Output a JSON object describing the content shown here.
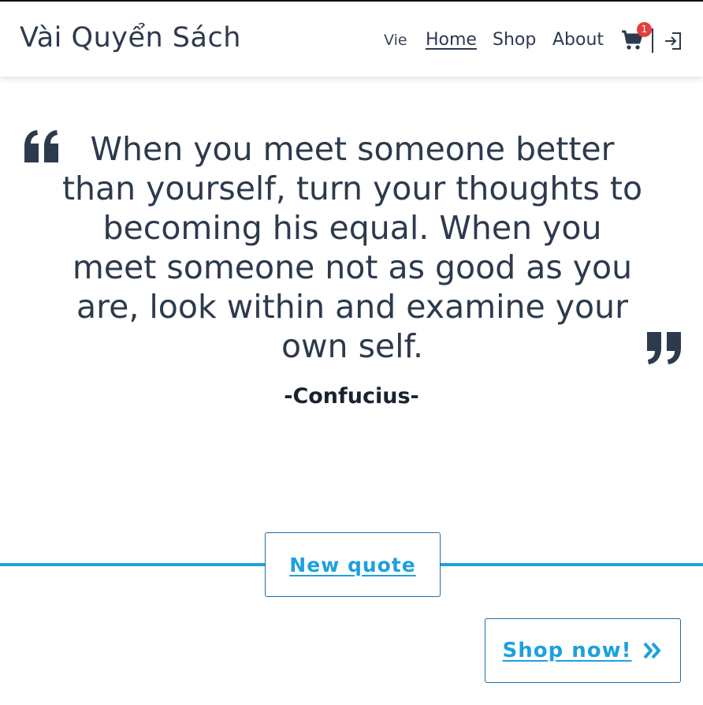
{
  "header": {
    "brand": "Vài Quyển Sách",
    "language": "Vie",
    "nav": {
      "home": "Home",
      "shop": "Shop",
      "about": "About"
    },
    "cart_count": "1"
  },
  "quote": {
    "text": "When you meet someone better than yourself, turn your thoughts to becoming his equal. When you meet someone not as good as you are, look within and examine your own self.",
    "author": "-Confucius-"
  },
  "buttons": {
    "new_quote": "New quote",
    "shop_now": "Shop now!"
  },
  "colors": {
    "text": "#2d3a4d",
    "accent": "#1ea0dc",
    "badge": "#e53e3e"
  },
  "icons": [
    "cart-icon",
    "login-icon",
    "quote-open-icon",
    "quote-close-icon",
    "double-chevron-right-icon"
  ]
}
